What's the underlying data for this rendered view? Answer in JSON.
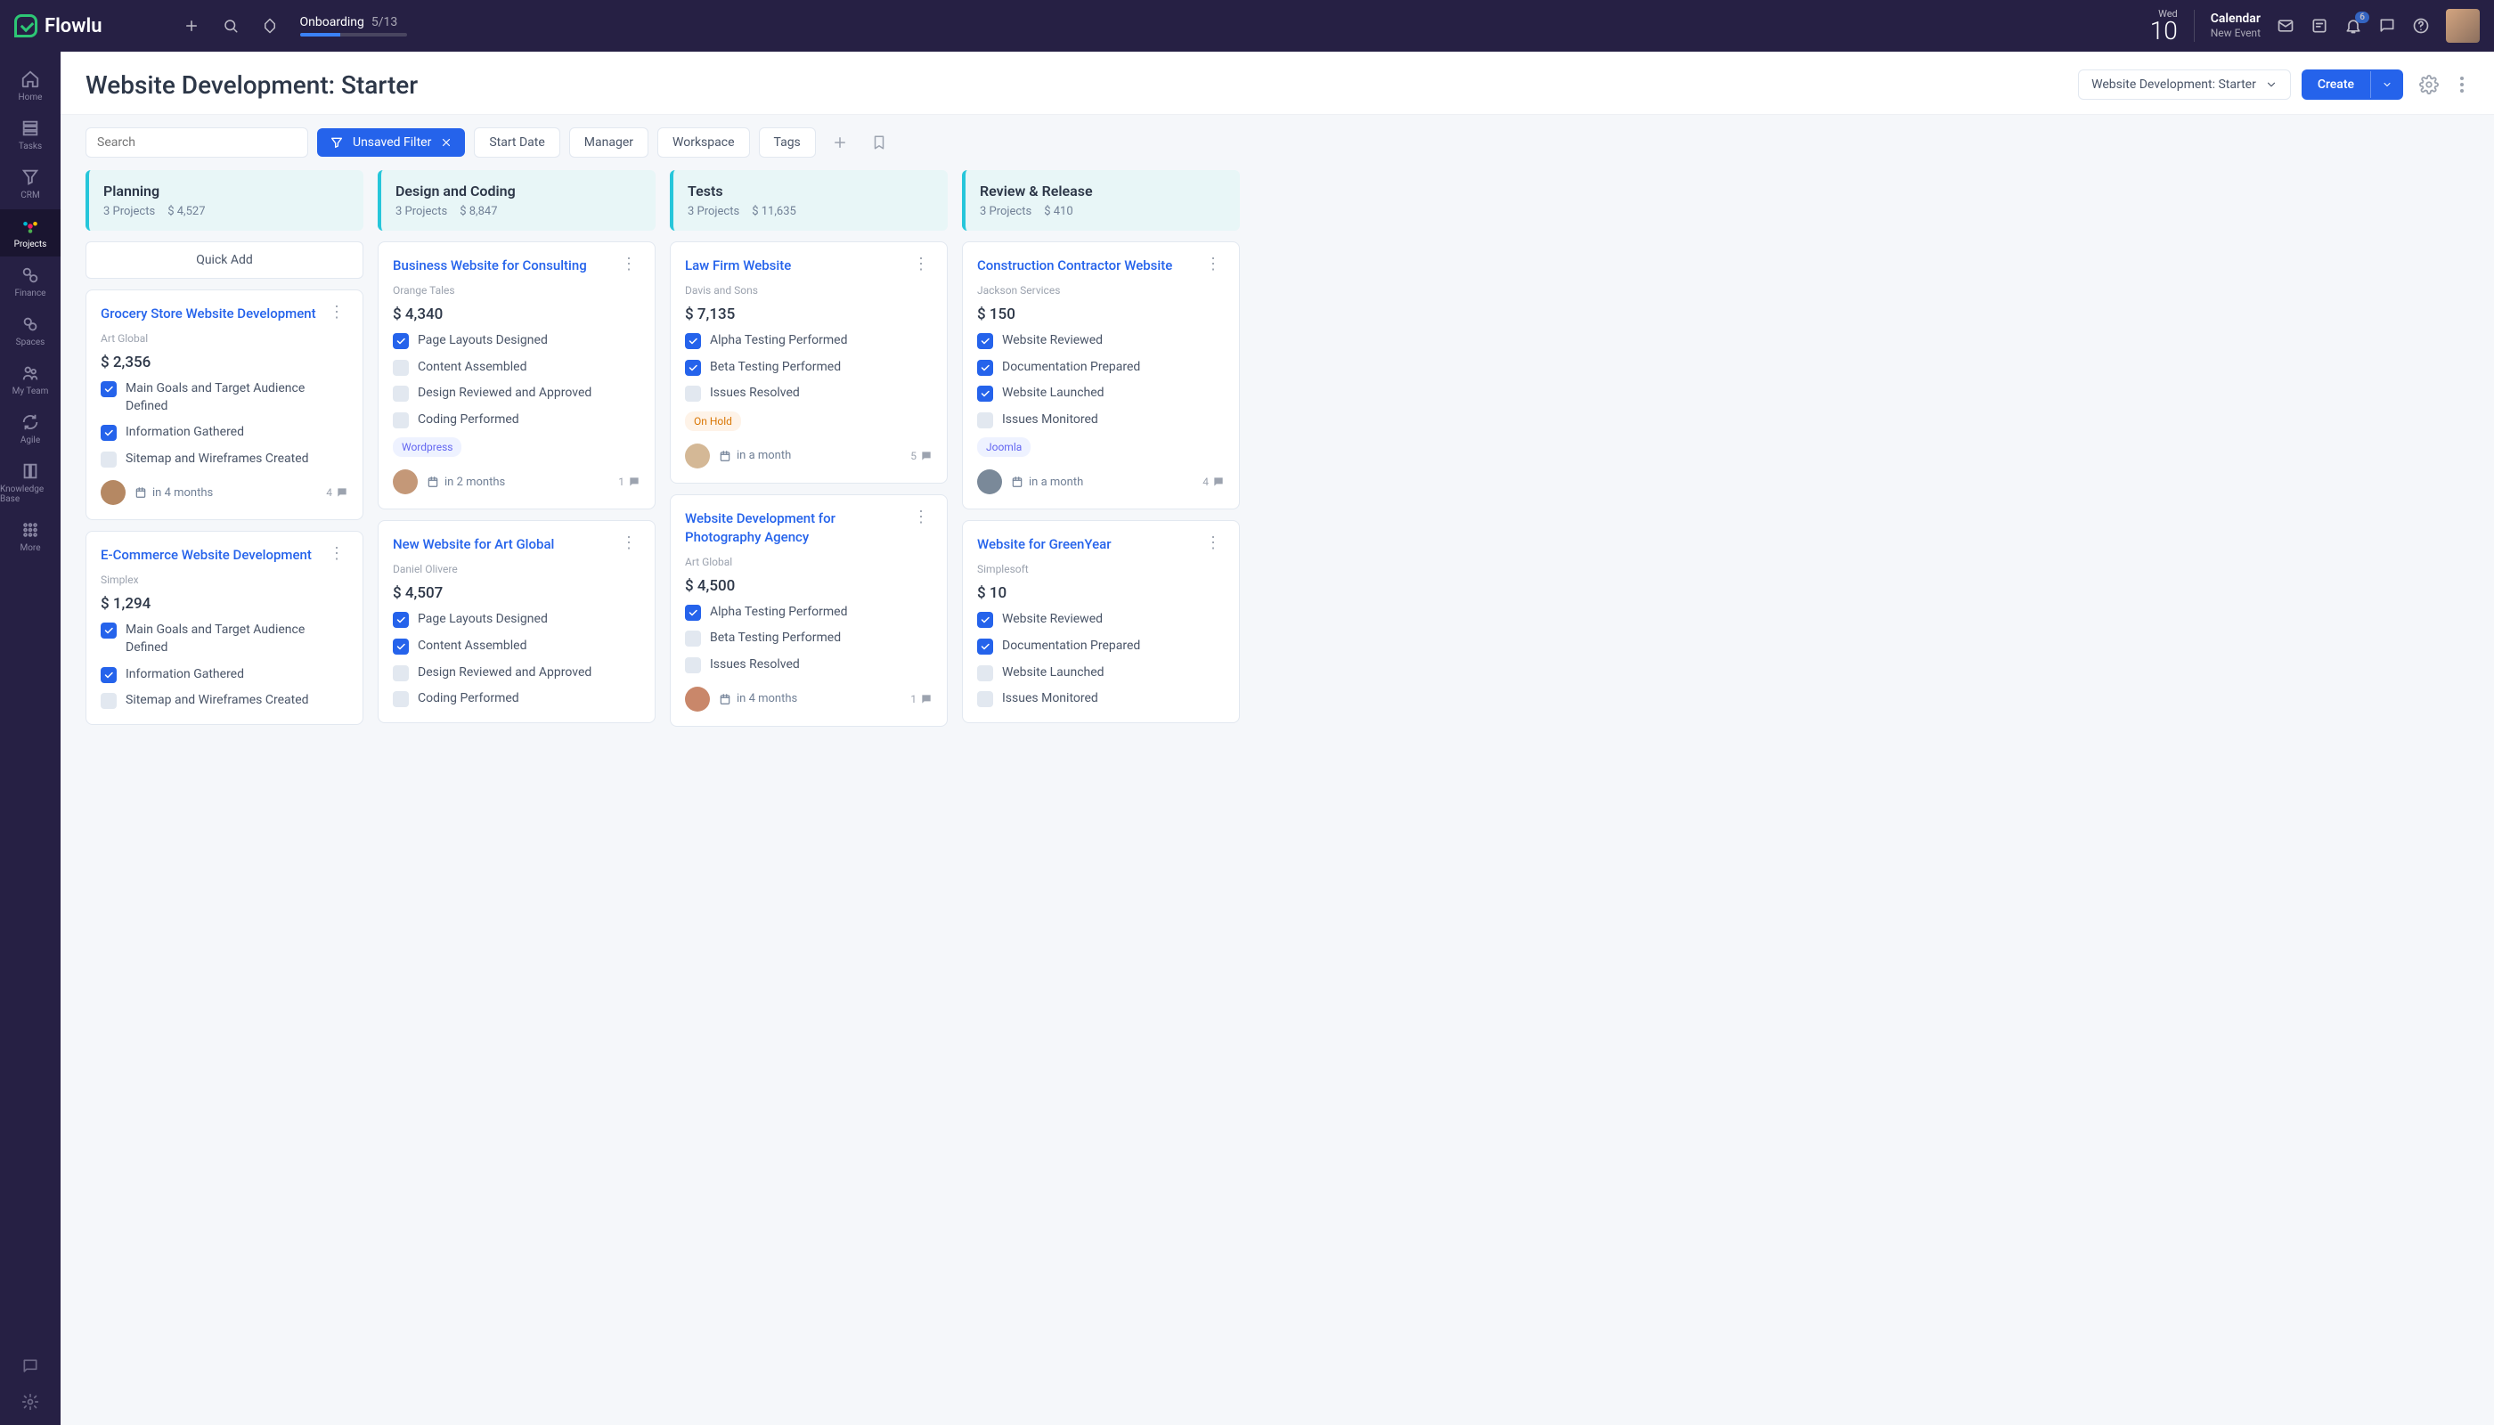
{
  "brand": "Flowlu",
  "onboarding": {
    "label": "Onboarding",
    "count": "5/13",
    "progress_pct": 38
  },
  "date": {
    "day_name": "Wed",
    "day_num": "10"
  },
  "calendar": {
    "title": "Calendar",
    "sub": "New Event"
  },
  "notif_count": "6",
  "sidebar": [
    {
      "label": "Home",
      "icon": "home"
    },
    {
      "label": "Tasks",
      "icon": "tasks"
    },
    {
      "label": "CRM",
      "icon": "funnel"
    },
    {
      "label": "Projects",
      "icon": "projects",
      "active": true
    },
    {
      "label": "Finance",
      "icon": "finance"
    },
    {
      "label": "Spaces",
      "icon": "spaces"
    },
    {
      "label": "My Team",
      "icon": "team"
    },
    {
      "label": "Agile",
      "icon": "agile"
    },
    {
      "label": "Knowledge Base",
      "icon": "kb"
    },
    {
      "label": "More",
      "icon": "more"
    }
  ],
  "page_title": "Website Development: Starter",
  "workflow_selector": "Website Development: Starter",
  "create_label": "Create",
  "search_placeholder": "Search",
  "filter_label": "Unsaved Filter",
  "chips": [
    "Start Date",
    "Manager",
    "Workspace",
    "Tags"
  ],
  "quick_add": "Quick Add",
  "columns": [
    {
      "title": "Planning",
      "projects": "3 Projects",
      "amount": "$ 4,527",
      "quick_add": true,
      "cards": [
        {
          "title": "Grocery Store Website Development",
          "sub": "Art Global",
          "amount": "$ 2,356",
          "tasks": [
            {
              "t": "Main Goals and Target Audience Defined",
              "c": true
            },
            {
              "t": "Information Gathered",
              "c": true
            },
            {
              "t": "Sitemap and Wireframes Created",
              "c": false
            }
          ],
          "due": "in 4 months",
          "avatar": "#b58863",
          "comments": "4"
        },
        {
          "title": "E-Commerce Website Development",
          "sub": "Simplex",
          "amount": "$ 1,294",
          "tasks": [
            {
              "t": "Main Goals and Target Audience Defined",
              "c": true
            },
            {
              "t": "Information Gathered",
              "c": true
            },
            {
              "t": "Sitemap and Wireframes Created",
              "c": false
            }
          ]
        }
      ]
    },
    {
      "title": "Design and Coding",
      "projects": "3 Projects",
      "amount": "$ 8,847",
      "cards": [
        {
          "title": "Business Website for Consulting",
          "sub": "Orange Tales",
          "amount": "$ 4,340",
          "tasks": [
            {
              "t": "Page Layouts Designed",
              "c": true
            },
            {
              "t": "Content Assembled",
              "c": false
            },
            {
              "t": "Design Reviewed and Approved",
              "c": false
            },
            {
              "t": "Coding Performed",
              "c": false
            }
          ],
          "tags": [
            {
              "text": "Wordpress",
              "cls": "wp"
            }
          ],
          "due": "in 2 months",
          "avatar": "#c49878",
          "comments": "1"
        },
        {
          "title": "New Website for Art Global",
          "sub": "Daniel Olivere",
          "amount": "$ 4,507",
          "tasks": [
            {
              "t": "Page Layouts Designed",
              "c": true
            },
            {
              "t": "Content Assembled",
              "c": true
            },
            {
              "t": "Design Reviewed and Approved",
              "c": false
            },
            {
              "t": "Coding Performed",
              "c": false
            }
          ]
        }
      ]
    },
    {
      "title": "Tests",
      "projects": "3 Projects",
      "amount": "$ 11,635",
      "cards": [
        {
          "title": "Law Firm Website",
          "sub": "Davis and Sons",
          "amount": "$ 7,135",
          "tasks": [
            {
              "t": "Alpha Testing Performed",
              "c": true
            },
            {
              "t": "Beta Testing Performed",
              "c": true
            },
            {
              "t": "Issues Resolved",
              "c": false
            }
          ],
          "tags": [
            {
              "text": "On Hold",
              "cls": "onhold"
            }
          ],
          "due": "in a month",
          "avatar": "#d4b896",
          "comments": "5"
        },
        {
          "title": "Website Development for Photography Agency",
          "sub": "Art Global",
          "amount": "$ 4,500",
          "tasks": [
            {
              "t": "Alpha Testing Performed",
              "c": true
            },
            {
              "t": "Beta Testing Performed",
              "c": false
            },
            {
              "t": "Issues Resolved",
              "c": false
            }
          ],
          "due": "in 4 months",
          "avatar": "#c9876a",
          "comments": "1"
        }
      ]
    },
    {
      "title": "Review & Release",
      "projects": "3 Projects",
      "amount": "$ 410",
      "cards": [
        {
          "title": "Construction Contractor Website",
          "sub": "Jackson Services",
          "amount": "$ 150",
          "tasks": [
            {
              "t": "Website Reviewed",
              "c": true
            },
            {
              "t": "Documentation Prepared",
              "c": true
            },
            {
              "t": "Website Launched",
              "c": true
            },
            {
              "t": "Issues Monitored",
              "c": false
            }
          ],
          "tags": [
            {
              "text": "Joomla",
              "cls": "joomla"
            }
          ],
          "due": "in a month",
          "avatar": "#7a8999",
          "comments": "4"
        },
        {
          "title": "Website for GreenYear",
          "sub": "Simplesoft",
          "amount": "$ 10",
          "tasks": [
            {
              "t": "Website Reviewed",
              "c": true
            },
            {
              "t": "Documentation Prepared",
              "c": true
            },
            {
              "t": "Website Launched",
              "c": false
            },
            {
              "t": "Issues Monitored",
              "c": false
            }
          ]
        }
      ]
    }
  ]
}
